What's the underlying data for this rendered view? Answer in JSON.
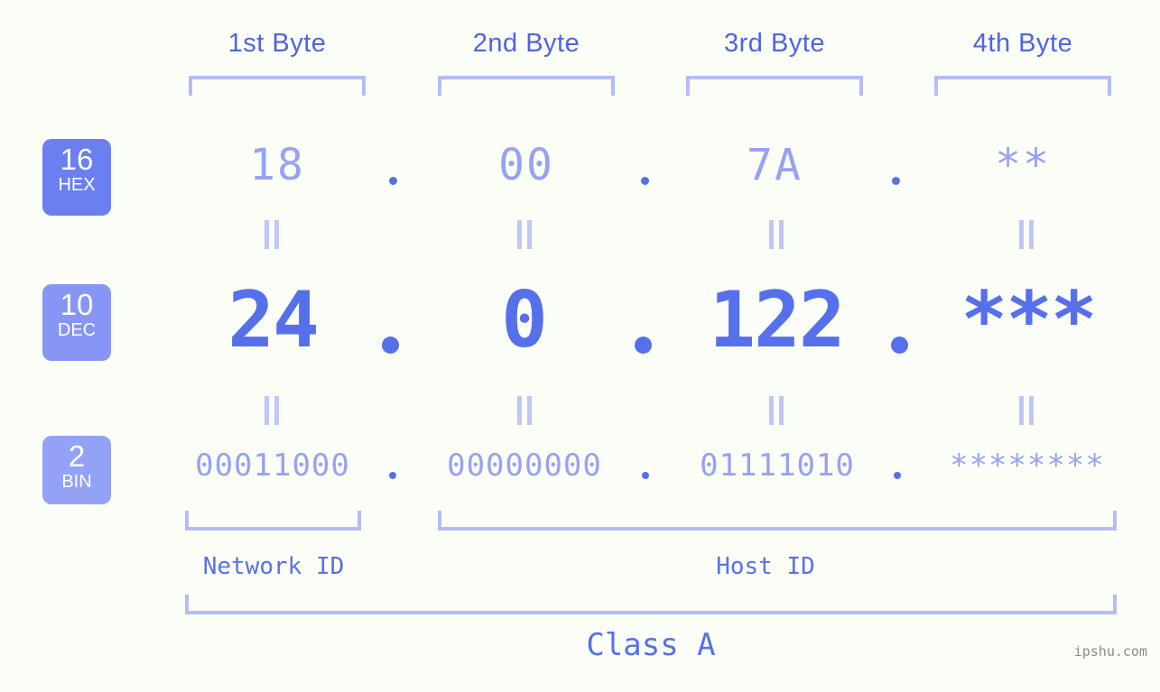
{
  "theme": {
    "background": "#fbfdf7",
    "accent_strong": "#5670ec",
    "accent_mid": "#97a2f2",
    "accent_light": "#b4bcf8",
    "badge_hex": "#6b7ff0",
    "badge_dec": "#8796f4",
    "badge_bin": "#93a2f6",
    "watermark_color": "#8a8a8a"
  },
  "byte_headers": [
    {
      "label": "1st Byte"
    },
    {
      "label": "2nd Byte"
    },
    {
      "label": "3rd Byte"
    },
    {
      "label": "4th Byte"
    }
  ],
  "rows": [
    {
      "key": "hex",
      "badge_num": "16",
      "badge_abbr": "HEX",
      "values": [
        "18",
        "00",
        "7A",
        "**"
      ],
      "separator": "."
    },
    {
      "key": "dec",
      "badge_num": "10",
      "badge_abbr": "DEC",
      "values": [
        "24",
        "0",
        "122",
        "***"
      ],
      "separator": "."
    },
    {
      "key": "bin",
      "badge_num": "2",
      "badge_abbr": "BIN",
      "values": [
        "00011000",
        "00000000",
        "01111010",
        "********"
      ],
      "separator": "."
    }
  ],
  "equality_symbol": "||",
  "id_sections": [
    {
      "label": "Network ID"
    },
    {
      "label": "Host ID"
    }
  ],
  "class_label": "Class A",
  "watermark": "ipshu.com"
}
